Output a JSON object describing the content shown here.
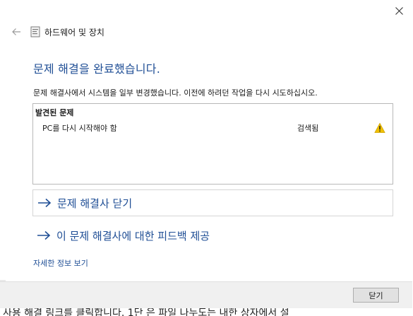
{
  "header": {
    "title": "하드웨어 및 장치",
    "back_icon": "back-arrow-icon",
    "app_icon": "troubleshooter-icon"
  },
  "main": {
    "title": "문제 해결을 완료했습니다.",
    "description": "문제 해결사에서 시스템을 일부 변경했습니다. 이전에 하려던 작업을 다시 시도하십시오."
  },
  "problems": {
    "header": "발견된 문제",
    "items": [
      {
        "name": "PC를 다시 시작해야 함",
        "status": "검색됨",
        "icon": "warning-icon"
      }
    ]
  },
  "actions": {
    "close_troubleshooter": "문제 해결사 닫기",
    "feedback": "이 문제 해결사에 대한 피드백 제공"
  },
  "details_link": "자세한 정보 보기",
  "footer": {
    "close_button": "닫기"
  },
  "background_text": "사용 해결 링크를 클릭합니다. 1단 은 파일 나누도는 내한 상자에서 설",
  "colors": {
    "accent": "#1f4e95",
    "footer_bg": "#f0f0f0",
    "warning": "#f0c000"
  }
}
